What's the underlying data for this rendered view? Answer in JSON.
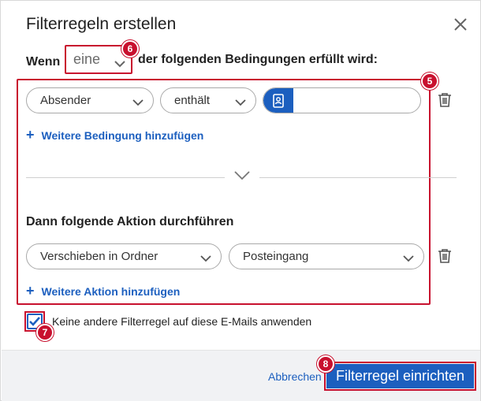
{
  "dialog": {
    "title": "Filterregeln erstellen",
    "close_icon": "close-icon"
  },
  "conditions": {
    "prefix": "Wenn",
    "mode_value": "eine",
    "suffix": "der folgenden Bedingungen erfüllt wird:",
    "field_value": "Absender",
    "operator_value": "enthält",
    "contact_icon": "contact-book-icon",
    "input_value": "",
    "add_label": "Weitere Bedingung hinzufügen"
  },
  "actions": {
    "title": "Dann folgende Aktion durchführen",
    "action_value": "Verschieben in Ordner",
    "target_value": "Posteingang",
    "add_label": "Weitere Aktion hinzufügen"
  },
  "options": {
    "stop_rules_label": "Keine andere Filterregel auf diese E-Mails anwenden",
    "stop_rules_checked": true
  },
  "footer": {
    "cancel_label": "Abbrechen",
    "submit_label": "Filterregel einrichten"
  },
  "annotations": {
    "badge_5": "5",
    "badge_6": "6",
    "badge_7": "7",
    "badge_8": "8"
  },
  "colors": {
    "accent": "#1c5fbf",
    "highlight": "#c8102e"
  }
}
